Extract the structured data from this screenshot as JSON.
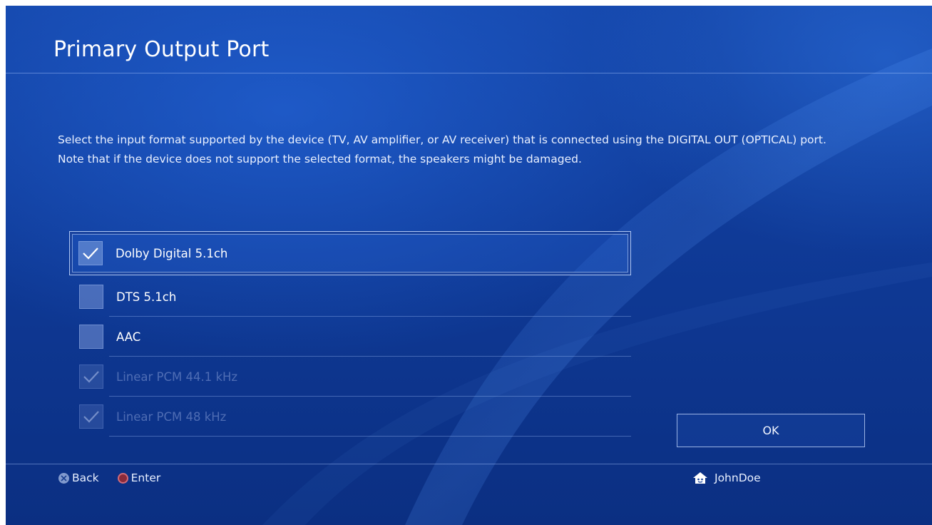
{
  "screen": {
    "title": "Primary Output Port",
    "description": [
      "Select the input format supported by the device (TV, AV amplifier, or AV receiver) that is connected using the DIGITAL OUT (OPTICAL) port.",
      "Note that if the device does not support the selected format, the speakers might be damaged."
    ]
  },
  "options": [
    {
      "label": "Dolby Digital 5.1ch",
      "checked": true,
      "enabled": true,
      "focused": true
    },
    {
      "label": "DTS 5.1ch",
      "checked": false,
      "enabled": true,
      "focused": false
    },
    {
      "label": "AAC",
      "checked": false,
      "enabled": true,
      "focused": false
    },
    {
      "label": "Linear PCM 44.1 kHz",
      "checked": true,
      "enabled": false,
      "focused": false
    },
    {
      "label": "Linear PCM 48 kHz",
      "checked": true,
      "enabled": false,
      "focused": false
    }
  ],
  "ok_button": {
    "label": "OK"
  },
  "footer": {
    "back_label": "Back",
    "back_icon": "cross-button-icon",
    "enter_label": "Enter",
    "enter_icon": "circle-button-icon",
    "user_name": "JohnDoe",
    "user_icon": "avatar-icon"
  },
  "colors": {
    "background": "#0f3a97",
    "text": "#ffffff",
    "disabled_text": "#7f92c4",
    "circle_button": "#8a2a3a"
  }
}
